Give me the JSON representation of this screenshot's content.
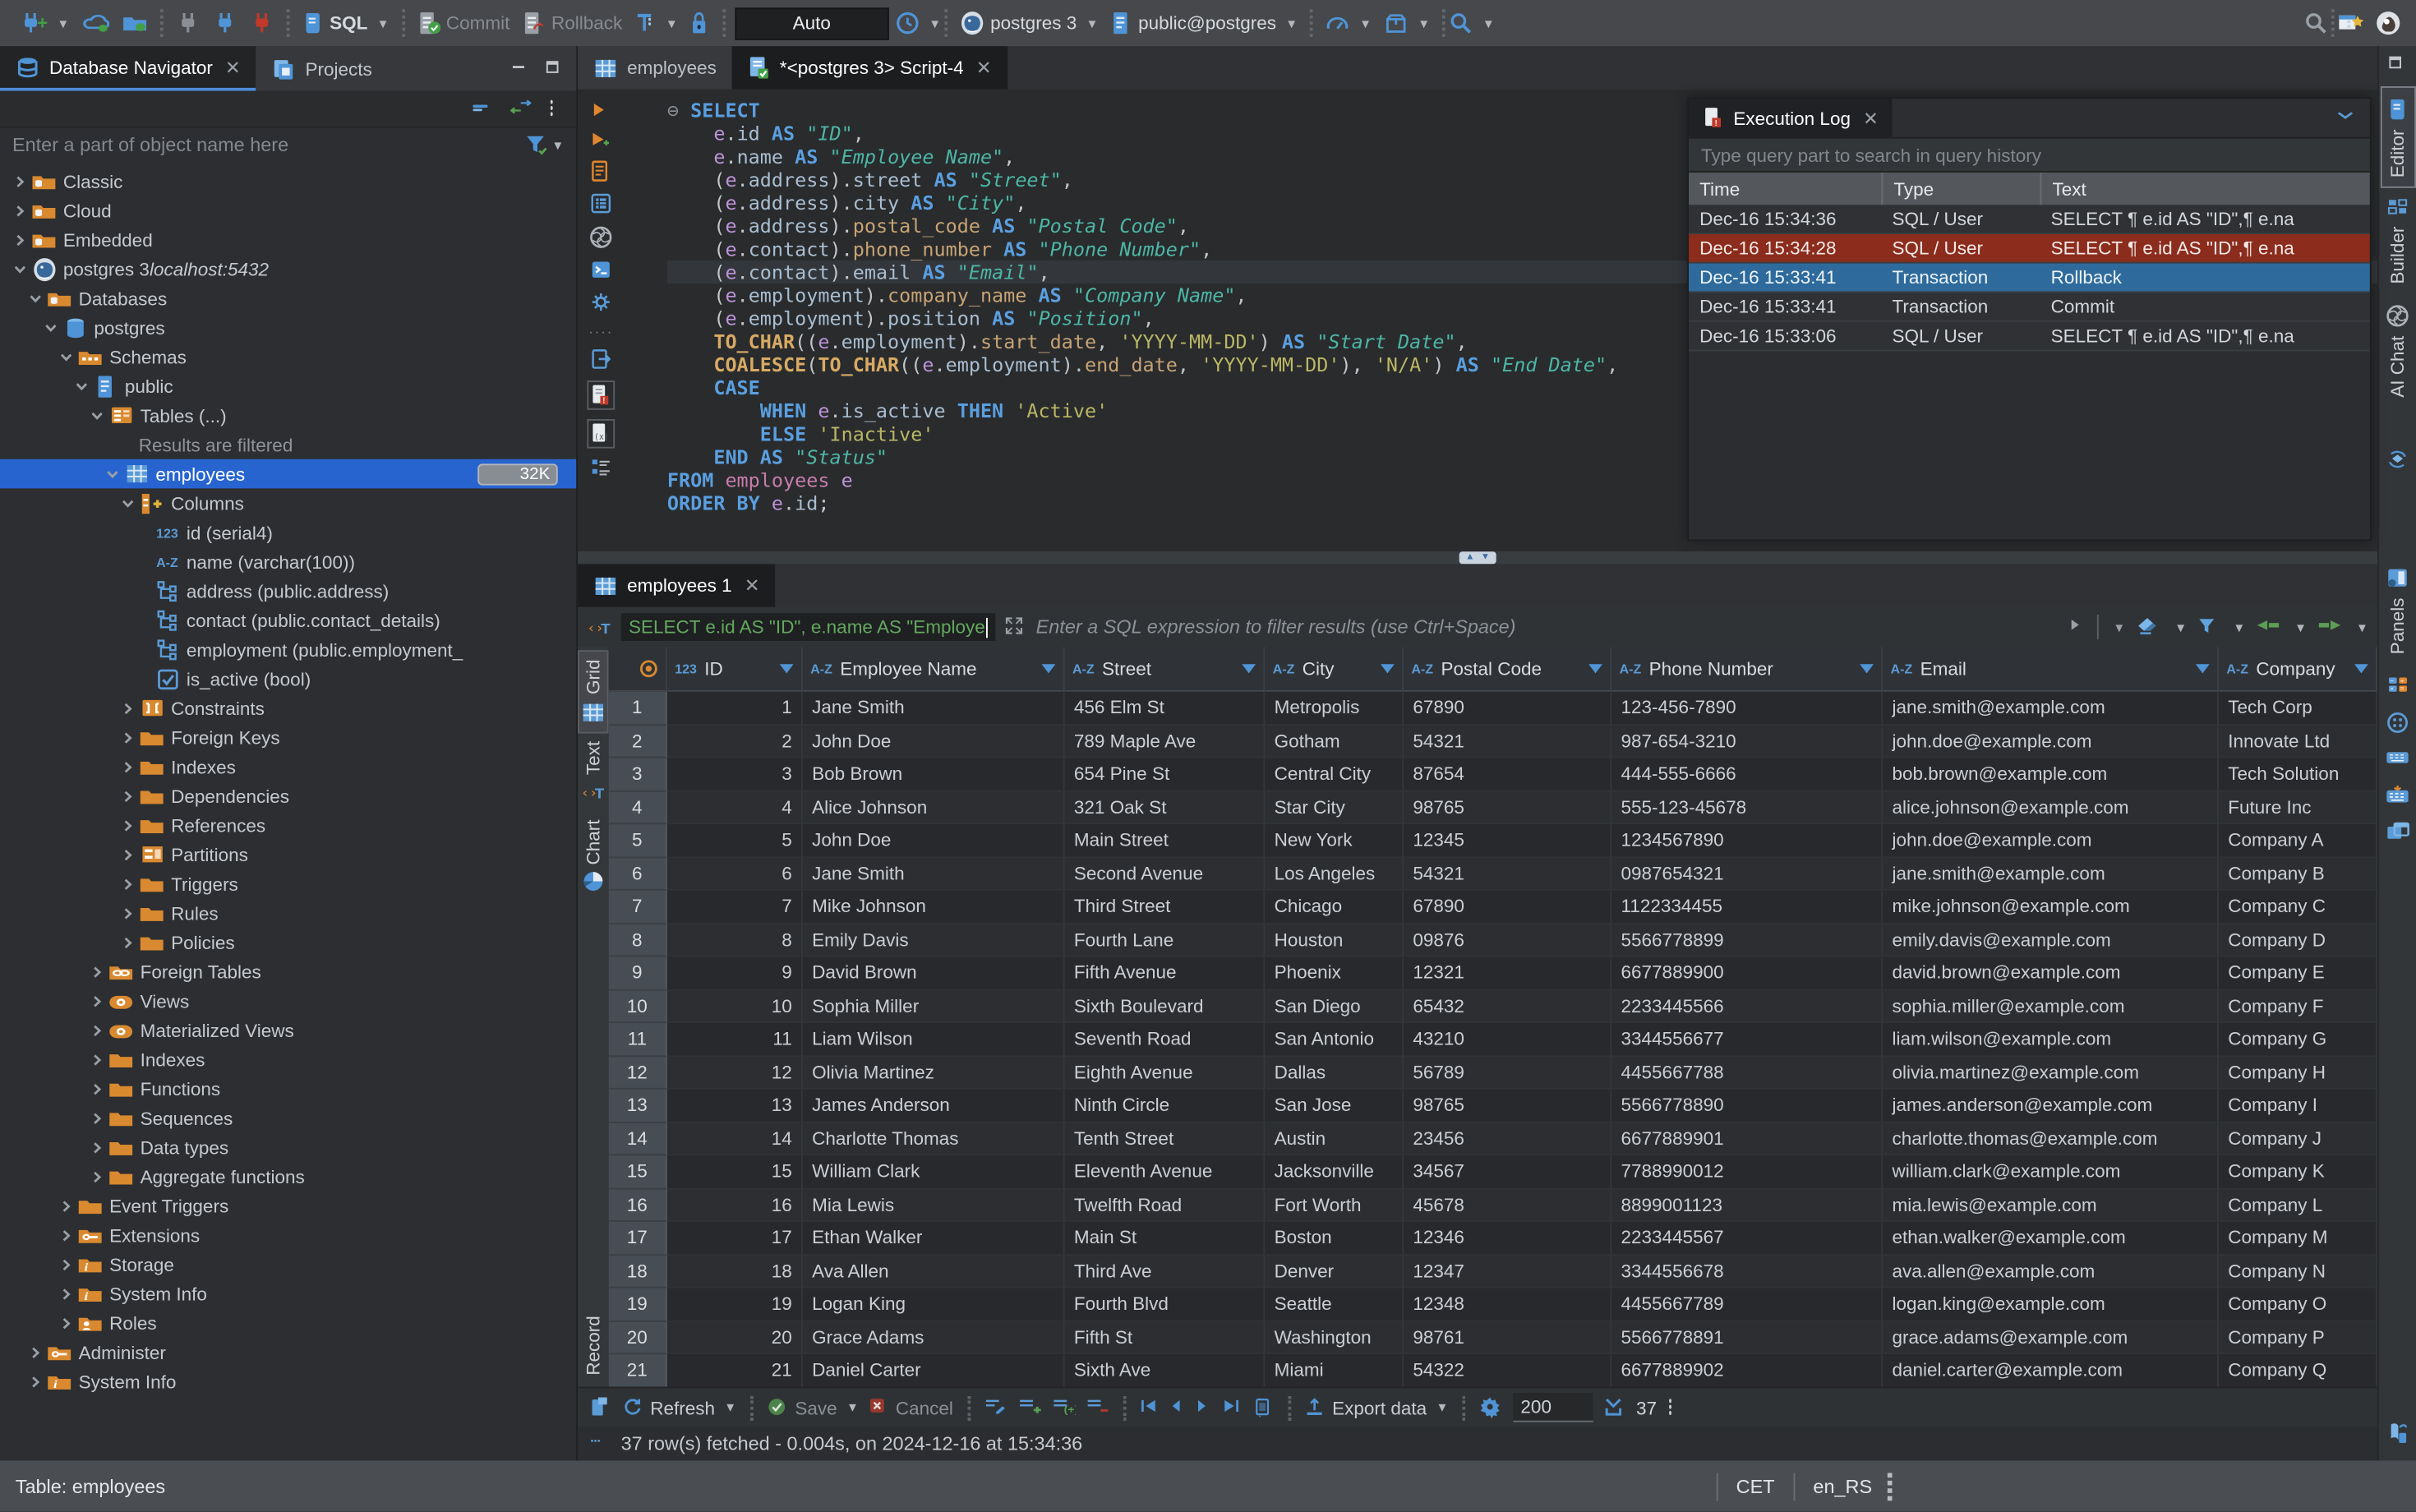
{
  "toolbar": {
    "sql": "SQL",
    "commit": "Commit",
    "rollback": "Rollback",
    "auto": "Auto",
    "connection": "postgres 3",
    "database": "public@postgres"
  },
  "navigator": {
    "tab_database_navigator": "Database Navigator",
    "tab_projects": "Projects",
    "filter_placeholder": "Enter a part of object name here",
    "tree": [
      {
        "l": 0,
        "e": ">",
        "i": "folderdb",
        "t": "Classic"
      },
      {
        "l": 0,
        "e": ">",
        "i": "folderdb",
        "t": "Cloud"
      },
      {
        "l": 0,
        "e": ">",
        "i": "folderdb",
        "t": "Embedded"
      },
      {
        "l": 0,
        "e": "v",
        "i": "pg",
        "t": "postgres 3 ",
        "suffix": "localhost:5432"
      },
      {
        "l": 1,
        "e": "v",
        "i": "folderdb",
        "t": "Databases"
      },
      {
        "l": 2,
        "e": "v",
        "i": "db",
        "t": "postgres"
      },
      {
        "l": 3,
        "e": "v",
        "i": "schema",
        "t": "Schemas"
      },
      {
        "l": 4,
        "e": "v",
        "i": "docblue",
        "t": "public"
      },
      {
        "l": 5,
        "e": "v",
        "i": "tables",
        "t": "Tables (...)"
      },
      {
        "l": 6,
        "note": "Results are filtered"
      },
      {
        "l": 6,
        "e": "v",
        "i": "tableblue",
        "t": "employees",
        "sel": true,
        "badge": "32K"
      },
      {
        "l": 7,
        "e": "v",
        "i": "columns",
        "t": "Columns"
      },
      {
        "l": 8,
        "i": "n123",
        "t": "id (serial4)"
      },
      {
        "l": 8,
        "i": "az",
        "t": "name (varchar(100))"
      },
      {
        "l": 8,
        "i": "struct",
        "t": "address (public.address)"
      },
      {
        "l": 8,
        "i": "struct",
        "t": "contact (public.contact_details)"
      },
      {
        "l": 8,
        "i": "struct",
        "t": "employment (public.employment_"
      },
      {
        "l": 8,
        "i": "check",
        "t": "is_active (bool)"
      },
      {
        "l": 7,
        "e": ">",
        "i": "brackets",
        "t": "Constraints"
      },
      {
        "l": 7,
        "e": ">",
        "i": "folder",
        "t": "Foreign Keys"
      },
      {
        "l": 7,
        "e": ">",
        "i": "folder",
        "t": "Indexes"
      },
      {
        "l": 7,
        "e": ">",
        "i": "folder",
        "t": "Dependencies"
      },
      {
        "l": 7,
        "e": ">",
        "i": "folder",
        "t": "References"
      },
      {
        "l": 7,
        "e": ">",
        "i": "partition",
        "t": "Partitions"
      },
      {
        "l": 7,
        "e": ">",
        "i": "folder",
        "t": "Triggers"
      },
      {
        "l": 7,
        "e": ">",
        "i": "folder",
        "t": "Rules"
      },
      {
        "l": 7,
        "e": ">",
        "i": "folder",
        "t": "Policies"
      },
      {
        "l": 5,
        "e": ">",
        "i": "linkfolder",
        "t": "Foreign Tables"
      },
      {
        "l": 5,
        "e": ">",
        "i": "eye",
        "t": "Views"
      },
      {
        "l": 5,
        "e": ">",
        "i": "eye",
        "t": "Materialized Views"
      },
      {
        "l": 5,
        "e": ">",
        "i": "folder",
        "t": "Indexes"
      },
      {
        "l": 5,
        "e": ">",
        "i": "folder",
        "t": "Functions"
      },
      {
        "l": 5,
        "e": ">",
        "i": "folder",
        "t": "Sequences"
      },
      {
        "l": 5,
        "e": ">",
        "i": "folder",
        "t": "Data types"
      },
      {
        "l": 5,
        "e": ">",
        "i": "folder",
        "t": "Aggregate functions"
      },
      {
        "l": 3,
        "e": ">",
        "i": "folder",
        "t": "Event Triggers"
      },
      {
        "l": 3,
        "e": ">",
        "i": "wrench",
        "t": "Extensions"
      },
      {
        "l": 3,
        "e": ">",
        "i": "info",
        "t": "Storage"
      },
      {
        "l": 3,
        "e": ">",
        "i": "info",
        "t": "System Info"
      },
      {
        "l": 3,
        "e": ">",
        "i": "user",
        "t": "Roles"
      },
      {
        "l": 1,
        "e": ">",
        "i": "wrench",
        "t": "Administer"
      },
      {
        "l": 1,
        "e": ">",
        "i": "info",
        "t": "System Info"
      }
    ]
  },
  "editor": {
    "tab_employees": "employees",
    "tab_script": "*<postgres 3> Script-4",
    "sql_lines": [
      [
        [
          "fold",
          "⊖ "
        ],
        [
          "k",
          "SELECT"
        ]
      ],
      [
        [
          "pl",
          "    "
        ],
        [
          "v",
          "e"
        ],
        [
          "p",
          "."
        ],
        [
          "c",
          "id"
        ],
        [
          "pl",
          " "
        ],
        [
          "k",
          "AS"
        ],
        [
          "pl",
          " "
        ],
        [
          "s",
          "\"ID\""
        ],
        [
          "p",
          ","
        ]
      ],
      [
        [
          "pl",
          "    "
        ],
        [
          "v",
          "e"
        ],
        [
          "p",
          "."
        ],
        [
          "c",
          "name"
        ],
        [
          "pl",
          " "
        ],
        [
          "k",
          "AS"
        ],
        [
          "pl",
          " "
        ],
        [
          "s",
          "\"Employee Name\""
        ],
        [
          "p",
          ","
        ]
      ],
      [
        [
          "pl",
          "    ("
        ],
        [
          "v",
          "e"
        ],
        [
          "p",
          "."
        ],
        [
          "c",
          "address"
        ],
        [
          "p",
          ")."
        ],
        [
          "c",
          "street"
        ],
        [
          "pl",
          " "
        ],
        [
          "k",
          "AS"
        ],
        [
          "pl",
          " "
        ],
        [
          "s",
          "\"Street\""
        ],
        [
          "p",
          ","
        ]
      ],
      [
        [
          "pl",
          "    ("
        ],
        [
          "v",
          "e"
        ],
        [
          "p",
          "."
        ],
        [
          "c",
          "address"
        ],
        [
          "p",
          ")."
        ],
        [
          "c",
          "city"
        ],
        [
          "pl",
          " "
        ],
        [
          "k",
          "AS"
        ],
        [
          "pl",
          " "
        ],
        [
          "s",
          "\"City\""
        ],
        [
          "p",
          ","
        ]
      ],
      [
        [
          "pl",
          "    ("
        ],
        [
          "v",
          "e"
        ],
        [
          "p",
          "."
        ],
        [
          "c",
          "address"
        ],
        [
          "p",
          ")."
        ],
        [
          "t",
          "postal_code"
        ],
        [
          "pl",
          " "
        ],
        [
          "k",
          "AS"
        ],
        [
          "pl",
          " "
        ],
        [
          "s",
          "\"Postal Code\""
        ],
        [
          "p",
          ","
        ]
      ],
      [
        [
          "pl",
          "    ("
        ],
        [
          "v",
          "e"
        ],
        [
          "p",
          "."
        ],
        [
          "c",
          "contact"
        ],
        [
          "p",
          ")."
        ],
        [
          "t",
          "phone_number"
        ],
        [
          "pl",
          " "
        ],
        [
          "k",
          "AS"
        ],
        [
          "pl",
          " "
        ],
        [
          "s",
          "\"Phone Number\""
        ],
        [
          "p",
          ","
        ]
      ],
      [
        [
          "pl",
          "    ("
        ],
        [
          "v",
          "e"
        ],
        [
          "p",
          "."
        ],
        [
          "c",
          "contact"
        ],
        [
          "p",
          ")."
        ],
        [
          "c",
          "email"
        ],
        [
          "pl",
          " "
        ],
        [
          "k",
          "AS"
        ],
        [
          "pl",
          " "
        ],
        [
          "s",
          "\"Email\""
        ],
        [
          "p",
          ","
        ]
      ],
      [
        [
          "pl",
          "    ("
        ],
        [
          "v",
          "e"
        ],
        [
          "p",
          "."
        ],
        [
          "c",
          "employment"
        ],
        [
          "p",
          ")."
        ],
        [
          "t",
          "company_name"
        ],
        [
          "pl",
          " "
        ],
        [
          "k",
          "AS"
        ],
        [
          "pl",
          " "
        ],
        [
          "s",
          "\"Company Name\""
        ],
        [
          "p",
          ","
        ]
      ],
      [
        [
          "pl",
          "    ("
        ],
        [
          "v",
          "e"
        ],
        [
          "p",
          "."
        ],
        [
          "c",
          "employment"
        ],
        [
          "p",
          ")."
        ],
        [
          "c",
          "position"
        ],
        [
          "pl",
          " "
        ],
        [
          "k",
          "AS"
        ],
        [
          "pl",
          " "
        ],
        [
          "s",
          "\"Position\""
        ],
        [
          "p",
          ","
        ]
      ],
      [
        [
          "pl",
          "    "
        ],
        [
          "f",
          "TO_CHAR"
        ],
        [
          "p",
          "(("
        ],
        [
          "v",
          "e"
        ],
        [
          "p",
          "."
        ],
        [
          "c",
          "employment"
        ],
        [
          "p",
          ")."
        ],
        [
          "t",
          "start_date"
        ],
        [
          "p",
          ", "
        ],
        [
          "q",
          "'YYYY-MM-DD'"
        ],
        [
          "p",
          ") "
        ],
        [
          "k",
          "AS"
        ],
        [
          "pl",
          " "
        ],
        [
          "s",
          "\"Start Date\""
        ],
        [
          "p",
          ","
        ]
      ],
      [
        [
          "pl",
          "    "
        ],
        [
          "f",
          "COALESCE"
        ],
        [
          "p",
          "("
        ],
        [
          "f",
          "TO_CHAR"
        ],
        [
          "p",
          "(("
        ],
        [
          "v",
          "e"
        ],
        [
          "p",
          "."
        ],
        [
          "c",
          "employment"
        ],
        [
          "p",
          ")."
        ],
        [
          "t",
          "end_date"
        ],
        [
          "p",
          ", "
        ],
        [
          "q",
          "'YYYY-MM-DD'"
        ],
        [
          "p",
          "), "
        ],
        [
          "q",
          "'N/A'"
        ],
        [
          "p",
          ") "
        ],
        [
          "k",
          "AS"
        ],
        [
          "pl",
          " "
        ],
        [
          "s",
          "\"End Date\""
        ],
        [
          "p",
          ","
        ]
      ],
      [
        [
          "pl",
          "    "
        ],
        [
          "k",
          "CASE"
        ]
      ],
      [
        [
          "pl",
          "        "
        ],
        [
          "k",
          "WHEN"
        ],
        [
          "pl",
          " "
        ],
        [
          "v",
          "e"
        ],
        [
          "p",
          "."
        ],
        [
          "c",
          "is_active"
        ],
        [
          "pl",
          " "
        ],
        [
          "k",
          "THEN"
        ],
        [
          "pl",
          " "
        ],
        [
          "q",
          "'Active'"
        ]
      ],
      [
        [
          "pl",
          "        "
        ],
        [
          "k",
          "ELSE"
        ],
        [
          "pl",
          " "
        ],
        [
          "q",
          "'Inactive'"
        ]
      ],
      [
        [
          "pl",
          "    "
        ],
        [
          "k",
          "END"
        ],
        [
          "pl",
          " "
        ],
        [
          "k",
          "AS"
        ],
        [
          "pl",
          " "
        ],
        [
          "s",
          "\"Status\""
        ]
      ],
      [
        [
          "k",
          "FROM"
        ],
        [
          "pl",
          " "
        ],
        [
          "tb",
          "employees"
        ],
        [
          "pl",
          " "
        ],
        [
          "v",
          "e"
        ]
      ],
      [
        [
          "k",
          "ORDER BY"
        ],
        [
          "pl",
          " "
        ],
        [
          "v",
          "e"
        ],
        [
          "p",
          "."
        ],
        [
          "c",
          "id"
        ],
        [
          "p",
          ";"
        ]
      ]
    ],
    "current_line_index": 7
  },
  "execution_log": {
    "title": "Execution Log",
    "search_placeholder": "Type query part to search in query history",
    "columns": [
      "Time",
      "Type",
      "Text"
    ],
    "rows": [
      {
        "time": "Dec-16 15:34:36",
        "type": "SQL / User",
        "text": "SELECT ¶   e.id AS \"ID\",¶   e.na"
      },
      {
        "time": "Dec-16 15:34:28",
        "type": "SQL / User",
        "text": "SELECT ¶   e.id AS \"ID\",¶   e.na",
        "state": "error"
      },
      {
        "time": "Dec-16 15:33:41",
        "type": "Transaction",
        "text": "Rollback",
        "state": "selected"
      },
      {
        "time": "Dec-16 15:33:41",
        "type": "Transaction",
        "text": "Commit"
      },
      {
        "time": "Dec-16 15:33:06",
        "type": "SQL / User",
        "text": "SELECT ¶   e.id AS \"ID\",¶   e.na"
      }
    ]
  },
  "results": {
    "tab": "employees 1",
    "filter_sql": "SELECT e.id AS \"ID\", e.name AS \"Employe",
    "filter_placeholder": "Enter a SQL expression to filter results (use Ctrl+Space)",
    "side_tabs": [
      "Grid",
      "Text",
      "Chart"
    ],
    "record_label": "Record",
    "columns": [
      {
        "type": "123",
        "label": "ID"
      },
      {
        "type": "A-Z",
        "label": "Employee Name"
      },
      {
        "type": "A-Z",
        "label": "Street"
      },
      {
        "type": "A-Z",
        "label": "City"
      },
      {
        "type": "A-Z",
        "label": "Postal Code"
      },
      {
        "type": "A-Z",
        "label": "Phone Number"
      },
      {
        "type": "A-Z",
        "label": "Email"
      },
      {
        "type": "A-Z",
        "label": "Company"
      }
    ],
    "rows": [
      [
        "1",
        "Jane Smith",
        "456 Elm St",
        "Metropolis",
        "67890",
        "123-456-7890",
        "jane.smith@example.com",
        "Tech Corp"
      ],
      [
        "2",
        "John Doe",
        "789 Maple Ave",
        "Gotham",
        "54321",
        "987-654-3210",
        "john.doe@example.com",
        "Innovate Ltd"
      ],
      [
        "3",
        "Bob Brown",
        "654 Pine St",
        "Central City",
        "87654",
        "444-555-6666",
        "bob.brown@example.com",
        "Tech Solution"
      ],
      [
        "4",
        "Alice Johnson",
        "321 Oak St",
        "Star City",
        "98765",
        "555-123-45678",
        "alice.johnson@example.com",
        "Future Inc"
      ],
      [
        "5",
        "John Doe",
        "Main Street",
        "New York",
        "12345",
        "1234567890",
        "john.doe@example.com",
        "Company A"
      ],
      [
        "6",
        "Jane Smith",
        "Second Avenue",
        "Los Angeles",
        "54321",
        "0987654321",
        "jane.smith@example.com",
        "Company B"
      ],
      [
        "7",
        "Mike Johnson",
        "Third Street",
        "Chicago",
        "67890",
        "1122334455",
        "mike.johnson@example.com",
        "Company C"
      ],
      [
        "8",
        "Emily Davis",
        "Fourth Lane",
        "Houston",
        "09876",
        "5566778899",
        "emily.davis@example.com",
        "Company D"
      ],
      [
        "9",
        "David Brown",
        "Fifth Avenue",
        "Phoenix",
        "12321",
        "6677889900",
        "david.brown@example.com",
        "Company E"
      ],
      [
        "10",
        "Sophia Miller",
        "Sixth Boulevard",
        "San Diego",
        "65432",
        "2233445566",
        "sophia.miller@example.com",
        "Company F"
      ],
      [
        "11",
        "Liam Wilson",
        "Seventh Road",
        "San Antonio",
        "43210",
        "3344556677",
        "liam.wilson@example.com",
        "Company G"
      ],
      [
        "12",
        "Olivia Martinez",
        "Eighth Avenue",
        "Dallas",
        "56789",
        "4455667788",
        "olivia.martinez@example.com",
        "Company H"
      ],
      [
        "13",
        "James Anderson",
        "Ninth Circle",
        "San Jose",
        "98765",
        "5566778890",
        "james.anderson@example.com",
        "Company I"
      ],
      [
        "14",
        "Charlotte Thomas",
        "Tenth Street",
        "Austin",
        "23456",
        "6677889901",
        "charlotte.thomas@example.com",
        "Company J"
      ],
      [
        "15",
        "William Clark",
        "Eleventh Avenue",
        "Jacksonville",
        "34567",
        "7788990012",
        "william.clark@example.com",
        "Company K"
      ],
      [
        "16",
        "Mia Lewis",
        "Twelfth Road",
        "Fort Worth",
        "45678",
        "8899001123",
        "mia.lewis@example.com",
        "Company L"
      ],
      [
        "17",
        "Ethan Walker",
        "Main St",
        "Boston",
        "12346",
        "2233445567",
        "ethan.walker@example.com",
        "Company M"
      ],
      [
        "18",
        "Ava Allen",
        "Third Ave",
        "Denver",
        "12347",
        "3344556678",
        "ava.allen@example.com",
        "Company N"
      ],
      [
        "19",
        "Logan King",
        "Fourth Blvd",
        "Seattle",
        "12348",
        "4455667789",
        "logan.king@example.com",
        "Company O"
      ],
      [
        "20",
        "Grace Adams",
        "Fifth St",
        "Washington",
        "98761",
        "5566778891",
        "grace.adams@example.com",
        "Company P"
      ],
      [
        "21",
        "Daniel Carter",
        "Sixth Ave",
        "Miami",
        "54322",
        "6677889902",
        "daniel.carter@example.com",
        "Company Q"
      ]
    ],
    "toolbar": {
      "refresh": "Refresh",
      "save": "Save",
      "cancel": "Cancel",
      "export": "Export data",
      "fetch_size": "200",
      "row_count": "37"
    },
    "status": "37 row(s) fetched - 0.004s, on 2024-12-16 at 15:34:36"
  },
  "rail": {
    "editor": "Editor",
    "builder": "Builder",
    "ai_chat": "AI Chat",
    "panels": "Panels"
  },
  "status_bar": {
    "table": "Table: employees",
    "timezone": "CET",
    "locale": "en_RS"
  }
}
